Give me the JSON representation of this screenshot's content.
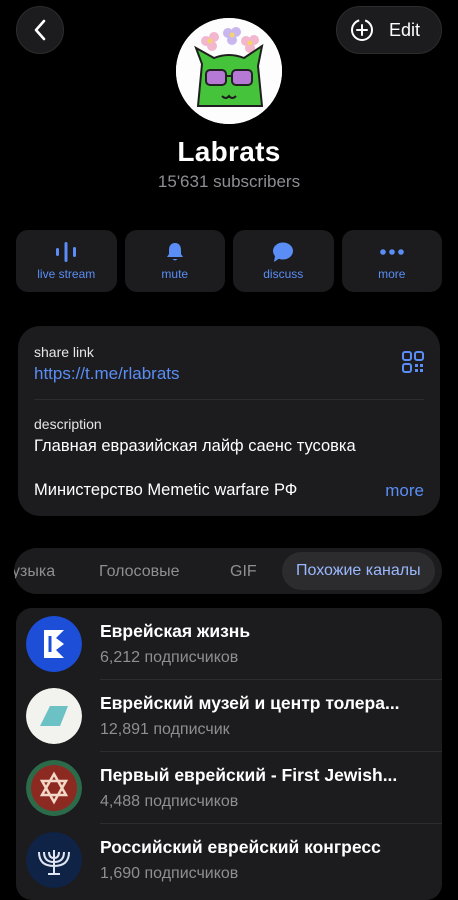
{
  "header": {
    "edit_label": "Edit"
  },
  "channel": {
    "title": "Labrats",
    "subscribers": "15'631 subscribers"
  },
  "actions": [
    {
      "label": "live stream",
      "icon": "live-stream-icon"
    },
    {
      "label": "mute",
      "icon": "bell-icon"
    },
    {
      "label": "discuss",
      "icon": "chat-bubble-icon"
    },
    {
      "label": "more",
      "icon": "more-dots-icon"
    }
  ],
  "info": {
    "share_label": "share link",
    "share_url": "https://t.me/rlabrats",
    "description_label": "description",
    "description_line1": "Главная евразийская лайф саенс тусовка",
    "description_line2": "Министерство Memetic warfare РФ",
    "more_label": "more"
  },
  "tabs": [
    {
      "label": "узыка"
    },
    {
      "label": "Голосовые"
    },
    {
      "label": "GIF"
    },
    {
      "label": "Похожие каналы",
      "active": true
    }
  ],
  "similar_channels": [
    {
      "name": "Еврейская жизнь",
      "subscribers": "6,212 подписчиков"
    },
    {
      "name": "Еврейский музей и центр толера...",
      "subscribers": "12,891 подписчик"
    },
    {
      "name": "Первый еврейский - First Jewish...",
      "subscribers": "4,488 подписчиков"
    },
    {
      "name": "Российский еврейский конгресс",
      "subscribers": "1,690 подписчиков"
    }
  ],
  "colors": {
    "accent": "#5a8df5",
    "background": "#000000",
    "card": "#1c1c1e",
    "secondary_text": "#8e8e93"
  }
}
